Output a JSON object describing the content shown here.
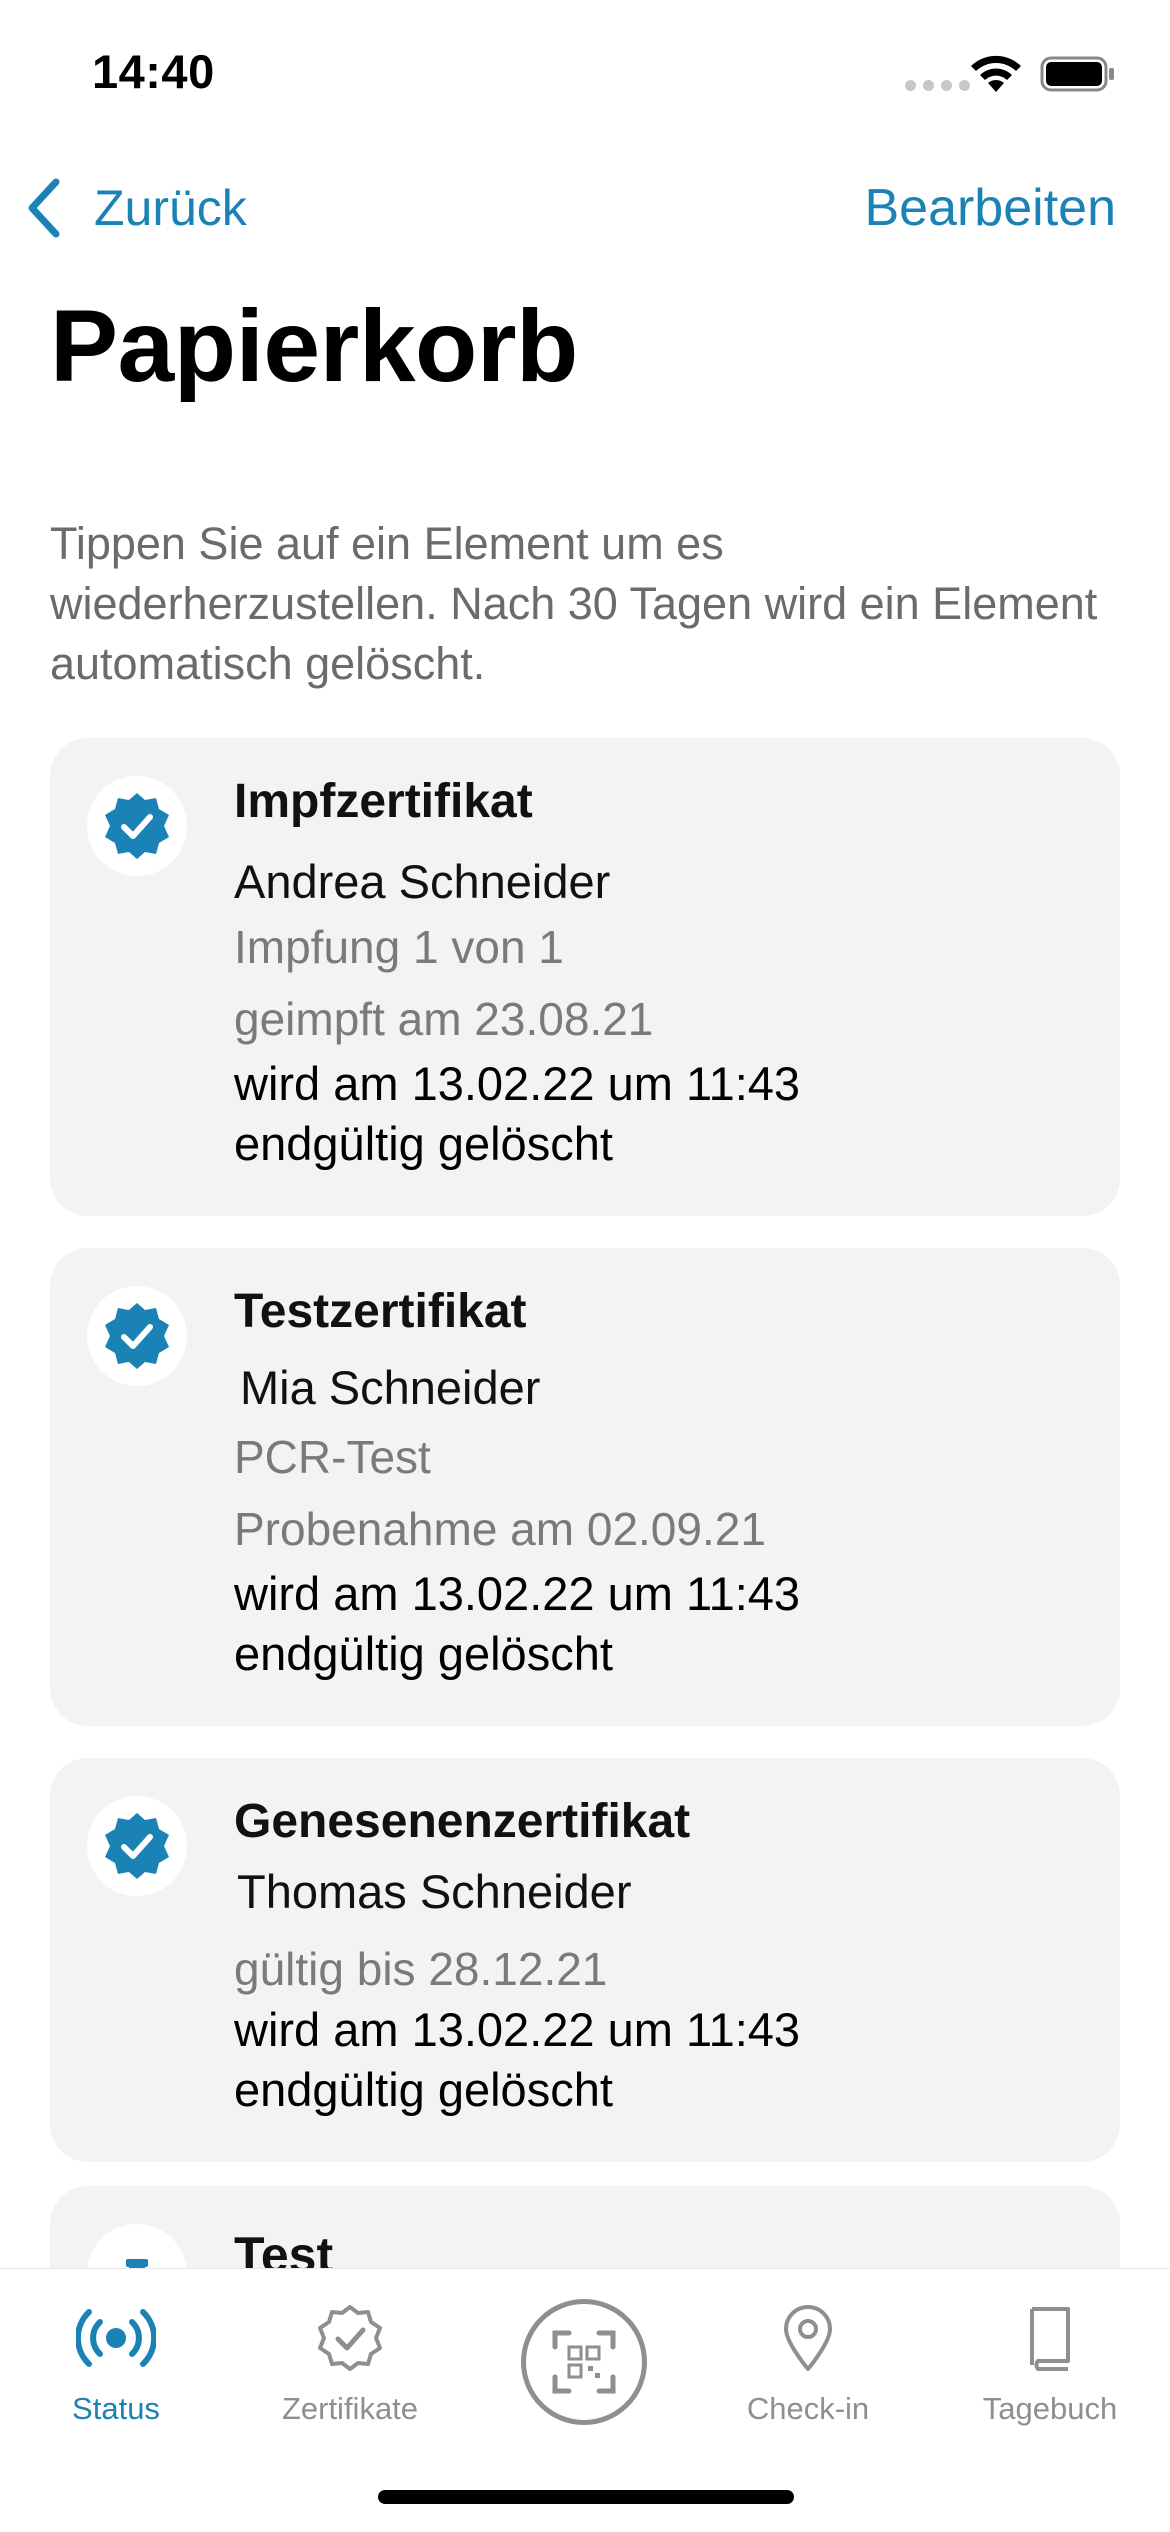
{
  "status_bar": {
    "time": "14:40"
  },
  "nav": {
    "back_label": "Zurück",
    "edit_label": "Bearbeiten"
  },
  "page": {
    "title": "Papierkorb",
    "hint": "Tippen Sie auf ein Element um es wiederherzustellen. Nach 30 Tagen wird ein Element automatisch gelöscht."
  },
  "items": [
    {
      "icon": "verified-badge-icon",
      "title": "Impfzertifikat",
      "name": "Andrea Schneider",
      "info1": "Impfung 1 von 1",
      "info2": "geimpft am 23.08.21",
      "deletion": "wird am 13.02.22 um 11:43 endgültig gelöscht"
    },
    {
      "icon": "verified-badge-icon",
      "title": "Testzertifikat",
      "name": "Mia Schneider",
      "info1": "PCR-Test",
      "info2": "Probenahme am 02.09.21",
      "deletion": "wird am 13.02.22 um 11:43 endgültig gelöscht"
    },
    {
      "icon": "verified-badge-icon",
      "title": "Genesenenzertifikat",
      "name": "Thomas Schneider",
      "info1": "gültig bis 28.12.21",
      "deletion": "wird am 13.02.22 um 11:43 endgültig gelöscht"
    },
    {
      "icon": "test-tube-icon",
      "title": "Test"
    }
  ],
  "tab_bar": {
    "tabs": [
      {
        "label": "Status",
        "icon": "broadcast-icon",
        "active": true
      },
      {
        "label": "Zertifikate",
        "icon": "certificate-badge-icon",
        "active": false
      },
      {
        "label": "",
        "icon": "qr-scan-icon",
        "active": false
      },
      {
        "label": "Check-in",
        "icon": "location-pin-icon",
        "active": false
      },
      {
        "label": "Tagebuch",
        "icon": "book-icon",
        "active": false
      }
    ]
  },
  "colors": {
    "accent": "#1b82b5",
    "card_background": "#f3f3f3",
    "secondary_text": "#7a7a7a",
    "inactive_tab": "#8e8e93"
  }
}
